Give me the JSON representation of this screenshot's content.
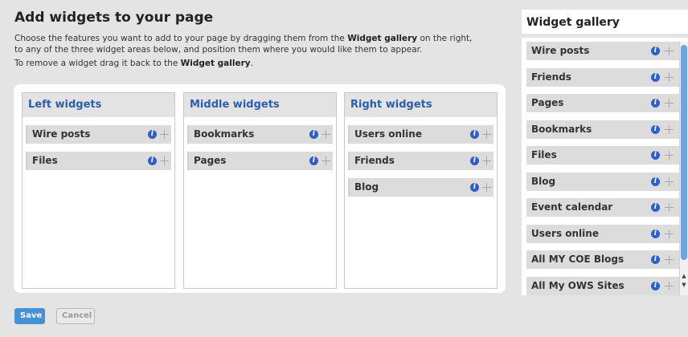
{
  "page": {
    "title": "Add widgets to your page",
    "intro_line1_a": "Choose the features you want to add to your page by dragging them from the ",
    "intro_line1_b": "Widget gallery",
    "intro_line1_c": " on the right,",
    "intro_line2": "to any of the three widget areas below, and position them where you would like them to appear.",
    "intro_line3_a": "To remove a widget drag it back to the ",
    "intro_line3_b": "Widget gallery",
    "intro_line3_c": "."
  },
  "columns": [
    {
      "title": "Left widgets",
      "widgets": [
        "Wire posts",
        "Files"
      ]
    },
    {
      "title": "Middle widgets",
      "widgets": [
        "Bookmarks",
        "Pages"
      ]
    },
    {
      "title": "Right widgets",
      "widgets": [
        "Users online",
        "Friends",
        "Blog"
      ]
    }
  ],
  "gallery": {
    "title": "Widget gallery",
    "items": [
      "Wire posts",
      "Friends",
      "Pages",
      "Bookmarks",
      "Files",
      "Blog",
      "Event calendar",
      "Users online",
      "All MY COE Blogs",
      "All My OWS Sites"
    ]
  },
  "buttons": {
    "save": "Save",
    "cancel": "Cancel"
  },
  "colors": {
    "heading_blue": "#2a5fb0",
    "save_button": "#4690d6",
    "info_icon": "#2d5fc6"
  }
}
